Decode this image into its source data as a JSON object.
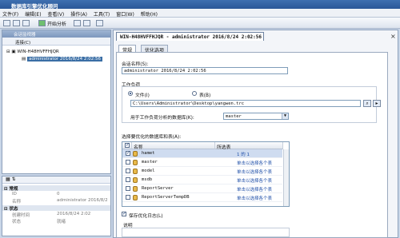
{
  "window": {
    "title": "数据库引擎优化顾问"
  },
  "menu": [
    "文件(F)",
    "编辑(E)",
    "查看(V)",
    "操作(A)",
    "工具(T)",
    "窗口(W)",
    "帮助(H)"
  ],
  "toolbar": {
    "start_label": "开始分析"
  },
  "session_monitor": {
    "title": "会话监视器",
    "connect_label": "连接(C)",
    "server_node": "WIN-H48HVFFHJQR",
    "session_node": "administrator 2016/8/24 2:02:56"
  },
  "properties": {
    "general_category": "常规",
    "id_key": "ID",
    "id_value": "0",
    "name_key": "名称",
    "name_value": "administrator 2016/8/2",
    "status_category": "状态",
    "created_key": "创建时间",
    "created_value": "2016/8/24 2:02",
    "state_key": "状态",
    "state_value": "就绪"
  },
  "document": {
    "tab_title": "WIN-H48HVFFHJQR - administrator 2016/8/24 2:02:56",
    "tabs": [
      "常规",
      "优化选项"
    ],
    "session_name_label": "会话名称(S):",
    "session_name_value": "administrator 2016/8/24 2:02:56",
    "workload_label": "工作负荷",
    "file_option": "文件(I)",
    "table_option": "表(B)",
    "workload_path": "C:\\Users\\Administrator\\Desktop\\yangwen.trc",
    "workload_db_label": "用于工作负荷分析的数据库(K):",
    "workload_db_value": "master",
    "db_tables_label": "选择要优化的数据库和表(A):",
    "grid_headers": {
      "name": "名称",
      "tables": "所选表"
    },
    "databases": [
      {
        "name": "hamet",
        "checked": true,
        "selected": true,
        "tables": "1 的 1"
      },
      {
        "name": "master",
        "checked": false,
        "selected": false,
        "tables": "单击以选择各个表"
      },
      {
        "name": "model",
        "checked": false,
        "selected": false,
        "tables": "单击以选择各个表"
      },
      {
        "name": "msdb",
        "checked": false,
        "selected": false,
        "tables": "单击以选择各个表"
      },
      {
        "name": "ReportServer",
        "checked": false,
        "selected": false,
        "tables": "单击以选择各个表"
      },
      {
        "name": "ReportServerTempDB",
        "checked": false,
        "selected": false,
        "tables": "单击以选择各个表"
      }
    ],
    "save_log_label": "保存优化日志(L)",
    "description_label": "说明"
  }
}
